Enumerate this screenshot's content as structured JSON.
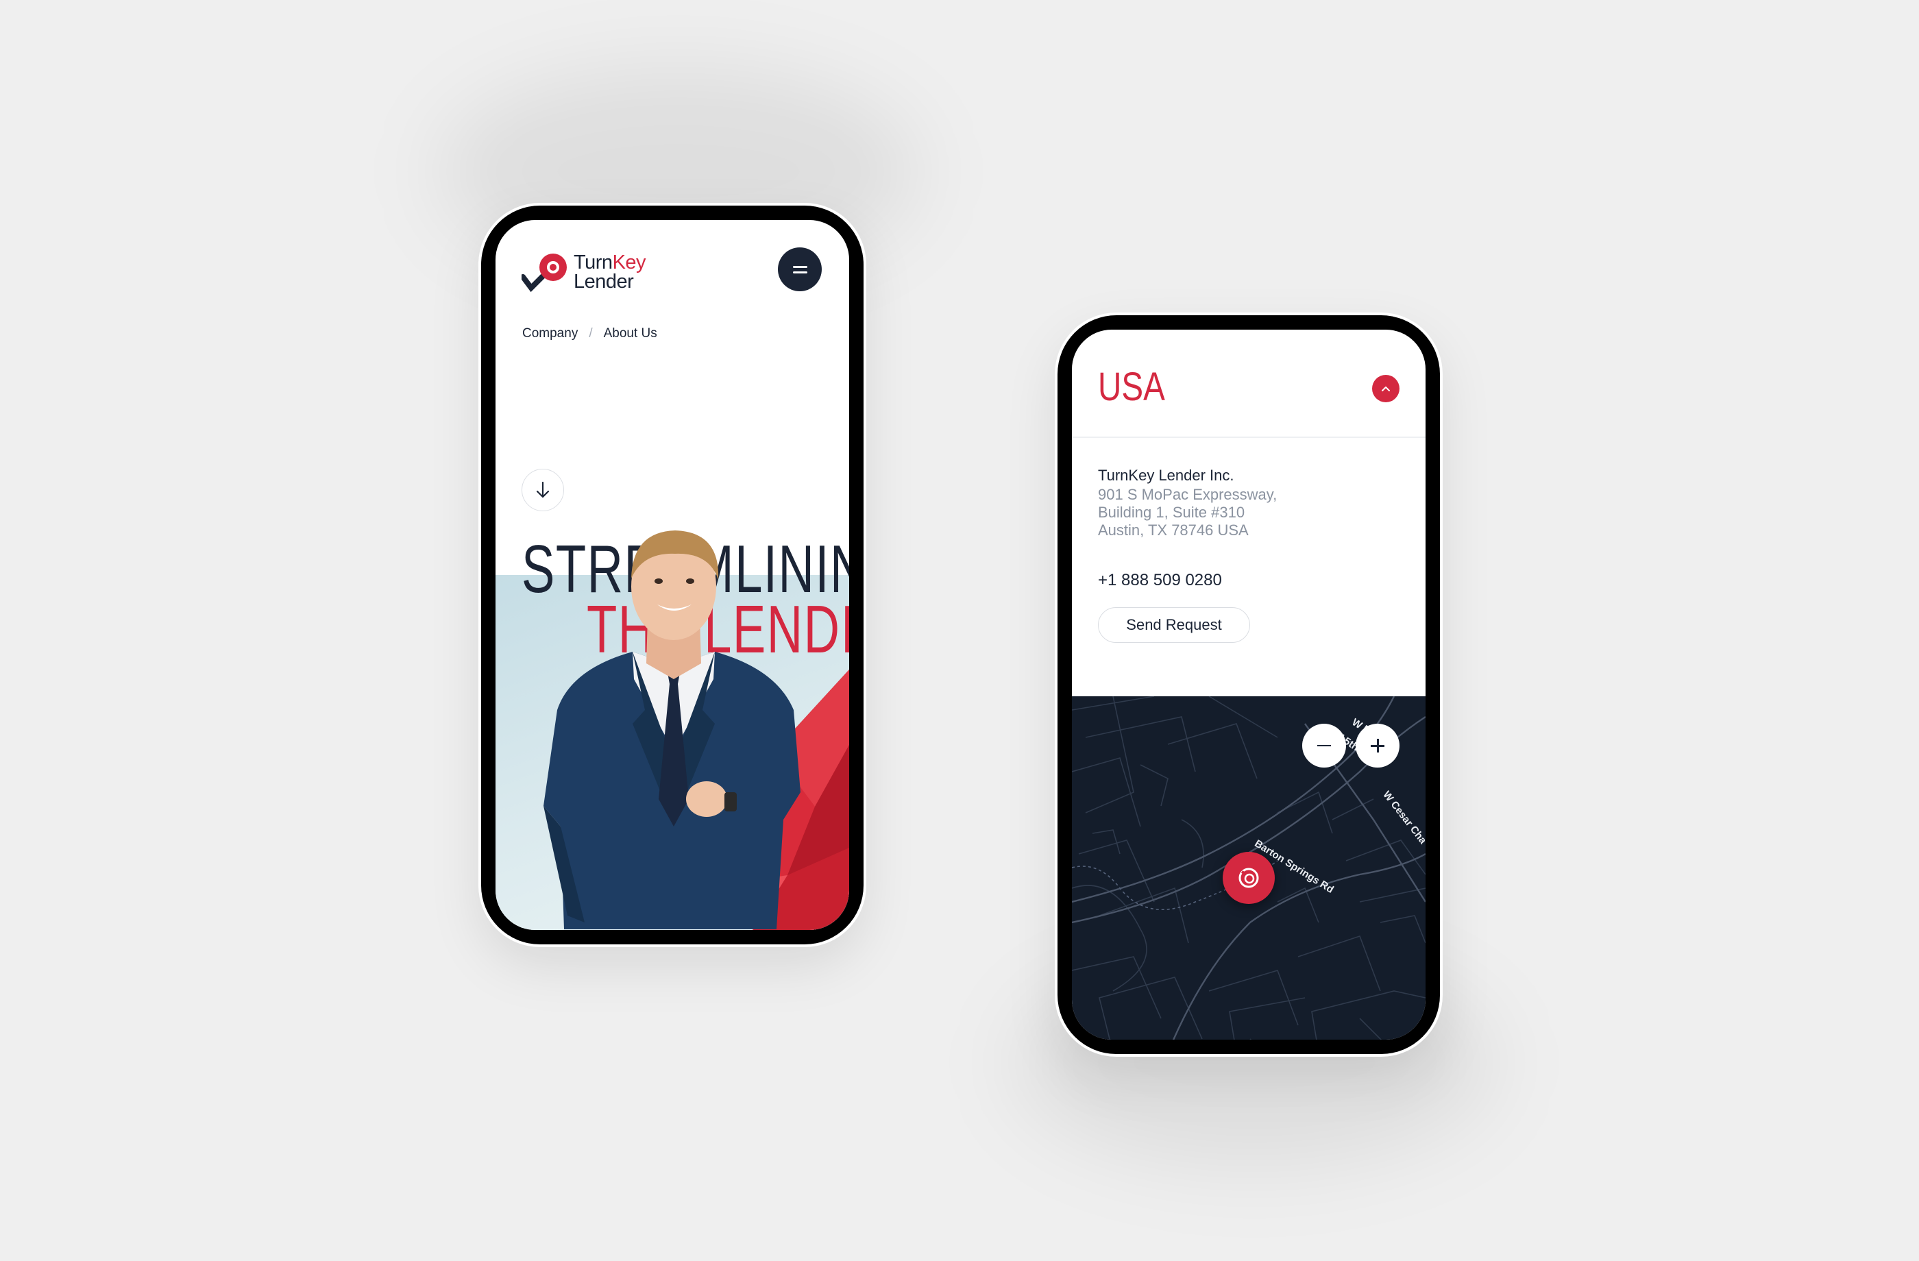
{
  "left_phone": {
    "logo": {
      "word1": "Turn",
      "word2": "Key",
      "word3": "Lender"
    },
    "breadcrumb": {
      "item1": "Company",
      "separator": "/",
      "item2": "About Us"
    },
    "hero": {
      "line1": "STREAMLININ",
      "line2": "THE LENDI"
    },
    "icons": {
      "menu": "hamburger-menu-icon",
      "scroll": "arrow-down-icon"
    }
  },
  "right_phone": {
    "country": "USA",
    "company": "TurnKey Lender Inc.",
    "address": [
      "901 S MoPac Expressway,",
      "Building 1, Suite #310",
      "Austin, TX 78746 USA"
    ],
    "phone": "+1 888 509 0280",
    "send_button": "Send Request",
    "map": {
      "streets": [
        "W 5th",
        "W 5th St",
        "W Cesar Cha",
        "Barton Springs Rd"
      ],
      "zoom_out": "−",
      "zoom_in": "+"
    },
    "icons": {
      "collapse": "chevron-up-icon",
      "pin": "location-pin-icon"
    }
  },
  "colors": {
    "brand_red": "#d42840",
    "navy": "#1b2435",
    "map_bg": "#141d2b",
    "page_bg": "#efefef"
  }
}
